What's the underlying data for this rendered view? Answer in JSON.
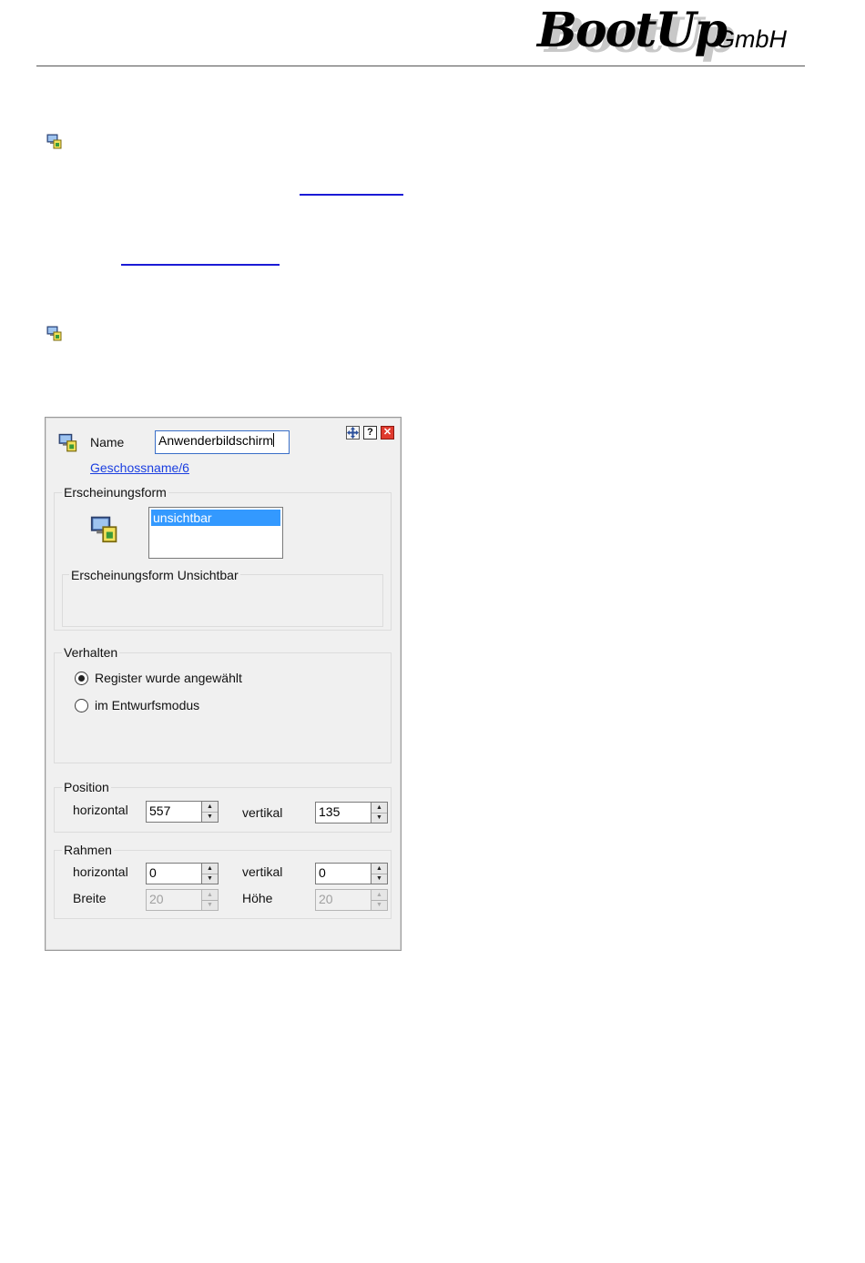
{
  "header": {
    "logo_brand": "BootUp",
    "logo_suffix": "GmbH"
  },
  "dialog": {
    "name_label": "Name",
    "name_value": "Anwenderbildschirm",
    "location_link": "Geschossname/6",
    "appearance": {
      "title": "Erscheinungsform",
      "options": [
        "unsichtbar"
      ],
      "selected": "unsichtbar",
      "sub_title": "Erscheinungsform Unsichtbar"
    },
    "behavior": {
      "title": "Verhalten",
      "options": [
        {
          "label": "Register wurde angewählt",
          "checked": true
        },
        {
          "label": "im Entwurfsmodus",
          "checked": false
        }
      ]
    },
    "position": {
      "title": "Position",
      "horizontal_label": "horizontal",
      "horizontal_value": "557",
      "vertical_label": "vertikal",
      "vertical_value": "135"
    },
    "frame": {
      "title": "Rahmen",
      "horizontal_label": "horizontal",
      "horizontal_value": "0",
      "vertical_label": "vertikal",
      "vertical_value": "0",
      "width_label": "Breite",
      "width_value": "20",
      "height_label": "Höhe",
      "height_value": "20"
    },
    "title_buttons": [
      "move-icon",
      "help-icon",
      "close-icon"
    ]
  },
  "colors": {
    "link": "#1a3ee0",
    "selection": "#3399ff",
    "close_button": "#e03a2e",
    "dialog_bg": "#f0f0f0"
  }
}
